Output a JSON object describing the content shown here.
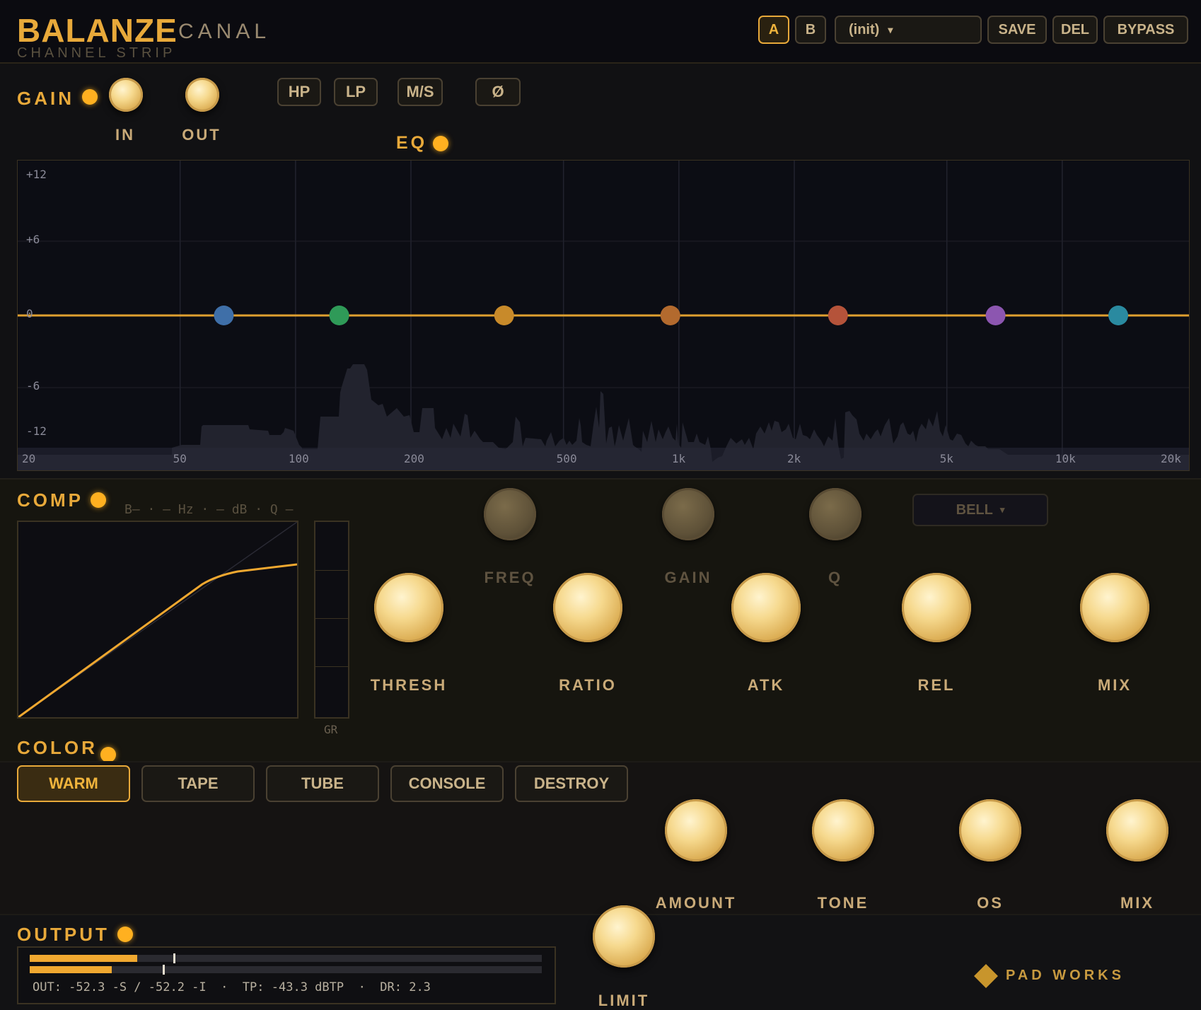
{
  "header": {
    "brand": "BALANZE",
    "product": "CANAL",
    "subtitle": "CHANNEL STRIP",
    "buttons": {
      "a": "A",
      "b": "B",
      "preset": "(init)",
      "preset_caret": "▾",
      "save": "SAVE",
      "del": "DEL",
      "bypass": "BYPASS"
    }
  },
  "gain": {
    "label": "GAIN",
    "in_label": "IN",
    "out_label": "OUT",
    "toggles": {
      "hp": "HP",
      "lp": "LP",
      "ms": "M/S",
      "phase": "Ø"
    }
  },
  "eq": {
    "label": "EQ",
    "db_ticks": [
      "+12",
      "+6",
      "0",
      "-6",
      "-12"
    ],
    "freq_ticks": [
      "20",
      "50",
      "100",
      "200",
      "500",
      "1k",
      "2k",
      "5k",
      "10k",
      "20k"
    ],
    "band_nodes": [
      {
        "freq": 65,
        "gain_db": 0,
        "color": "#3f6fa8"
      },
      {
        "freq": 130,
        "gain_db": 0,
        "color": "#2f9a58"
      },
      {
        "freq": 350,
        "gain_db": 0,
        "color": "#c88a2a"
      },
      {
        "freq": 950,
        "gain_db": 0,
        "color": "#b36a2e"
      },
      {
        "freq": 2600,
        "gain_db": 0,
        "color": "#b5533a"
      },
      {
        "freq": 6700,
        "gain_db": 0,
        "color": "#8c56b0"
      },
      {
        "freq": 14000,
        "gain_db": 0,
        "color": "#2a8aa0"
      }
    ],
    "curve_color": "#e0a02f",
    "band_readout": "B– · — Hz · — dB · Q —",
    "band_knobs": {
      "freq": "FREQ",
      "gain": "GAIN",
      "q": "Q"
    },
    "shape": "BELL",
    "shape_caret": "▾"
  },
  "comp": {
    "label": "COMP",
    "gr_label": "GR",
    "knobs": {
      "thresh": "THRESH",
      "ratio": "RATIO",
      "atk": "ATK",
      "rel": "REL",
      "mix": "MIX"
    }
  },
  "color": {
    "label": "COLOR",
    "modes": [
      "WARM",
      "TAPE",
      "TUBE",
      "CONSOLE",
      "DESTROY"
    ],
    "selected": "WARM",
    "knobs": {
      "amount": "AMOUNT",
      "tone": "TONE",
      "os": "OS",
      "mix": "MIX"
    }
  },
  "output": {
    "label": "OUTPUT",
    "meter_levels": [
      0.21,
      0.16
    ],
    "meter_peaks": [
      0.28,
      0.26
    ],
    "readout": "OUT: -52.3 -S / -52.2 -I  ·  TP: -43.3 dBTP  ·  DR: 2.3",
    "limit_label": "LIMIT"
  },
  "footer": {
    "brand": "PAD WORKS"
  }
}
